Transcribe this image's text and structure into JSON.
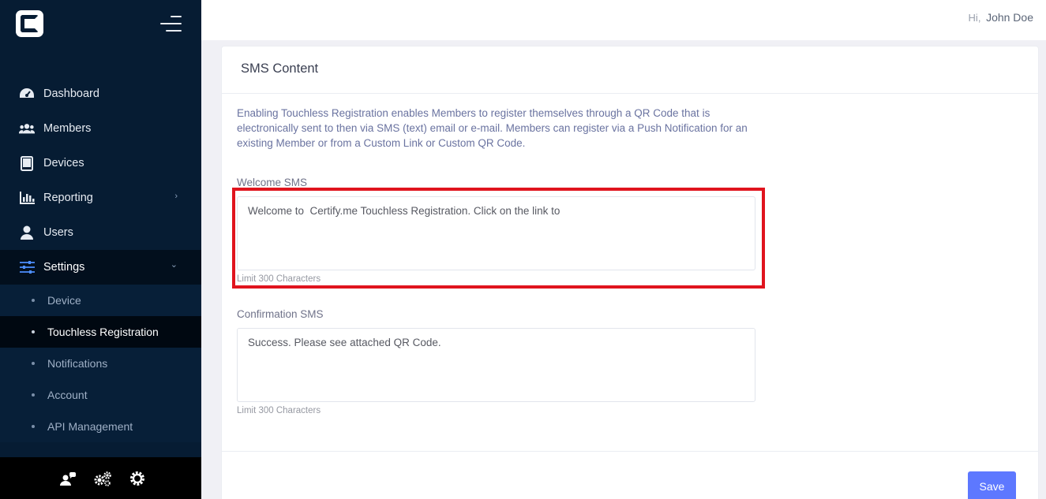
{
  "sidebar": {
    "logo_icon": "certify-c-logo",
    "menu_icon": "hamburger-menu-icon",
    "items": [
      {
        "label": "Dashboard",
        "icon": "speedometer-icon"
      },
      {
        "label": "Members",
        "icon": "users-group-icon"
      },
      {
        "label": "Devices",
        "icon": "tablet-icon"
      },
      {
        "label": "Reporting",
        "icon": "bar-chart-icon"
      },
      {
        "label": "Users",
        "icon": "user-icon"
      },
      {
        "label": "Settings",
        "icon": "sliders-icon"
      }
    ],
    "settings_sub": [
      {
        "label": "Device"
      },
      {
        "label": "Touchless Registration"
      },
      {
        "label": "Notifications"
      },
      {
        "label": "Account"
      },
      {
        "label": "API Management"
      }
    ],
    "footer_icons": [
      "user-chat-icon",
      "cogs-icon",
      "gear-icon"
    ]
  },
  "header": {
    "greeting": "Hi,",
    "user_name": "John Doe"
  },
  "card": {
    "title": "SMS Content",
    "description": "Enabling Touchless Registration enables Members to register themselves through a QR Code that is electronically sent to then via SMS (text) email or e-mail. Members can register via a Push Notification for an existing Member or from a Custom Link or Custom QR Code.",
    "welcome": {
      "label": "Welcome SMS",
      "value": "Welcome to  Certify.me Touchless Registration. Click on the link to",
      "hint": "Limit 300 Characters"
    },
    "confirmation": {
      "label": "Confirmation SMS",
      "value": "Success. Please see attached QR Code.",
      "hint": "Limit 300 Characters"
    },
    "save_label": "Save"
  },
  "colors": {
    "sidebar_bg": "#061c33",
    "accent": "#5d78ff",
    "highlight": "#e0141e",
    "settings_icon": "#4d8fff"
  }
}
